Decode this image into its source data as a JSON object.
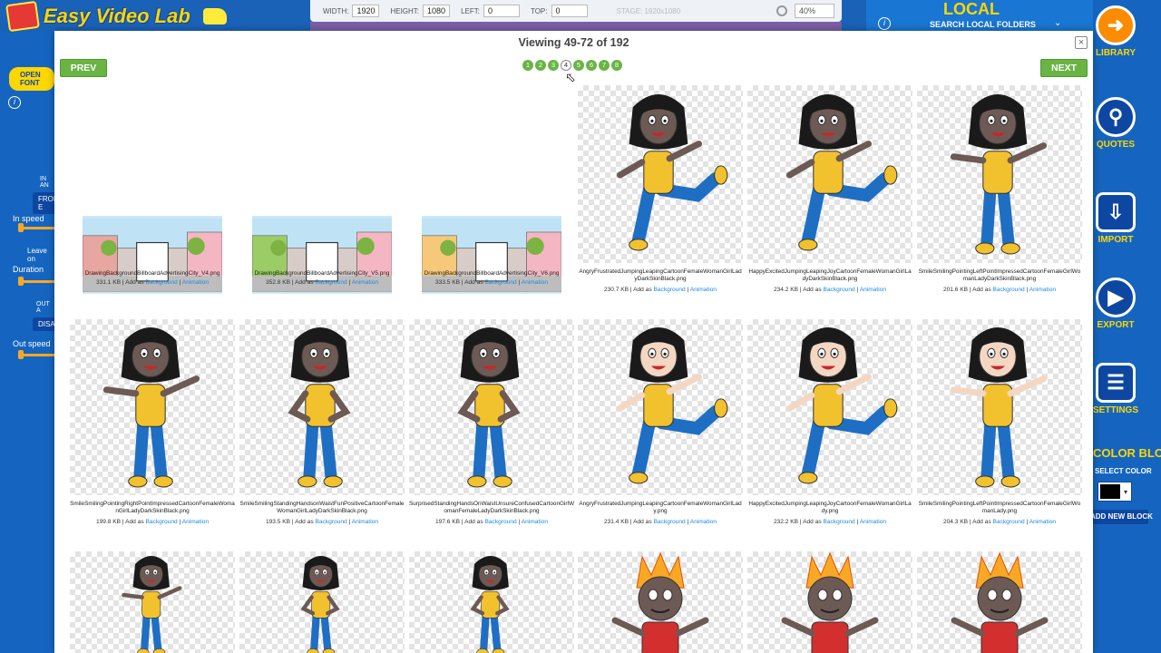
{
  "app": {
    "logo_text": "Easy Video Lab",
    "open_font_label": "OPEN FONT",
    "stage": {
      "width_label": "WIDTH:",
      "width_value": "1920",
      "height_label": "HEIGHT:",
      "height_value": "1080",
      "left_label": "LEFT:",
      "left_value": "0",
      "top_label": "TOP:",
      "top_value": "0",
      "stage_note": "STAGE: 1920x1080",
      "zoom": "40%"
    },
    "left_panel": {
      "in_label": "IN AN",
      "from_label": "FROM E",
      "in_speed": "In speed",
      "leave_on": "Leave on",
      "duration": "Duration",
      "out_label": "OUT A",
      "disa_label": "DISA",
      "out_speed": "Out speed"
    },
    "local": {
      "title": "LOCAL",
      "subtitle": "SEARCH LOCAL FOLDERS"
    },
    "side_buttons": [
      {
        "name": "library",
        "label": "LIBRARY",
        "icon": "arrow-left-icon"
      },
      {
        "name": "quotes",
        "label": "QUOTES",
        "icon": "search-icon"
      },
      {
        "name": "import",
        "label": "IMPORT",
        "icon": "import-icon"
      },
      {
        "name": "export",
        "label": "EXPORT",
        "icon": "play-icon"
      },
      {
        "name": "settings",
        "label": "SETTINGS",
        "icon": "clipboard-icon"
      }
    ],
    "color_block": {
      "title": "COLOR BLOCK",
      "select_color": "SELECT COLOR",
      "selected": "#000000",
      "add_new": "ADD NEW BLOCK"
    }
  },
  "modal": {
    "title": "Viewing 49-72 of 192",
    "prev_label": "PREV",
    "next_label": "NEXT",
    "pages": [
      "1",
      "2",
      "3",
      "4",
      "5",
      "6",
      "7",
      "8"
    ],
    "current_page": "4",
    "add_as_text": "Add as",
    "bg_link": "Background",
    "anim_link": "Animation",
    "items": [
      {
        "file": "DrawingBackgroundBillboardAdvertisingCity_V4.png",
        "size": "331.1 KB",
        "kind": "scene"
      },
      {
        "file": "DrawingBackgroundBillboardAdvertisingCity_V5.png",
        "size": "352.8 KB",
        "kind": "scene"
      },
      {
        "file": "DrawingBackgroundBillboardAdvertisingCity_V6.png",
        "size": "333.5 KB",
        "kind": "scene"
      },
      {
        "file": "AngryFrustratedJumpingLeapingCartoonFemaleWomanGirlLadyDarkSkinBlack.png",
        "size": "230.7 KB",
        "kind": "girl-dark-kick"
      },
      {
        "file": "HappyExcitedJumpingLeapingJoyCartoonFemaleWomanGirlLadyDarkSkinBlack.png",
        "size": "234.2 KB",
        "kind": "girl-dark-kick"
      },
      {
        "file": "SmileSmilingPointingLeftPointImpressedCartoonFemaleGirlWomanLadyDarkSkinBlack.png",
        "size": "201.6 KB",
        "kind": "girl-dark-point"
      },
      {
        "file": "SmileSmilingPointingRightPointImpressedCartoonFemaleWomanGirlLadyDarkSkinBlack.png",
        "size": "199.8 KB",
        "kind": "girl-dark-point"
      },
      {
        "file": "SmileSmilingStandingHandsonWaistFunPositiveCartoonFemaleWomanGirlLadyDarkSkinBlack.png",
        "size": "193.5 KB",
        "kind": "girl-dark-stand"
      },
      {
        "file": "SurprisedStandingHandsOnWaistUnsureConfusedCartoonGirlWomanFemaleLadyDarkSkinBlack.png",
        "size": "197.6 KB",
        "kind": "girl-dark-stand"
      },
      {
        "file": "AngryFrustratedJumpingLeapingCartoonFemaleWomanGirlLady.png",
        "size": "231.4 KB",
        "kind": "girl-light-kick"
      },
      {
        "file": "HappyExcitedJumpingLeapingJoyCartoonFemaleWomanGirlLady.png",
        "size": "232.2 KB",
        "kind": "girl-light-kick"
      },
      {
        "file": "SmileSmilingPointingLeftPointImpressedCartoonFemaleGirlWomanLady.png",
        "size": "204.3 KB",
        "kind": "girl-light-point"
      }
    ]
  }
}
